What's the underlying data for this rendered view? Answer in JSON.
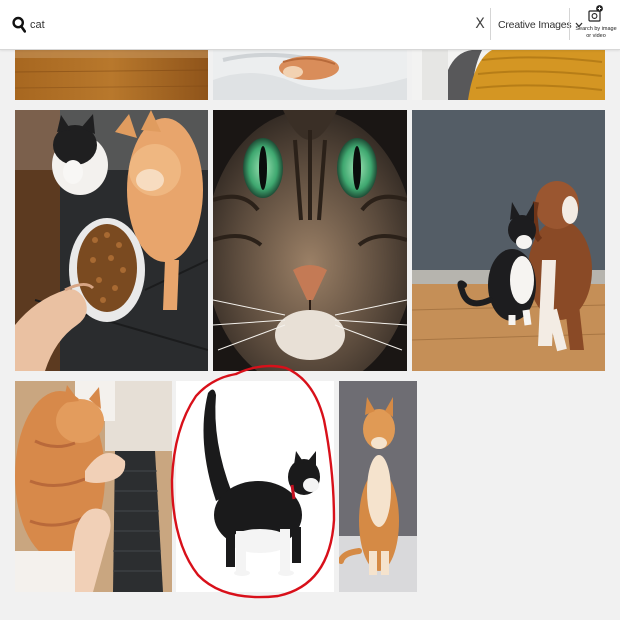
{
  "search": {
    "query": "cat",
    "clear_label": "X",
    "filter_label": "Creative Images",
    "image_search_label": "Search by image or video"
  },
  "colors": {
    "annotation": "#d8101a",
    "page_background": "#f1f1f1"
  },
  "results": [
    {
      "subject": "wooden floor",
      "selected": false
    },
    {
      "subject": "cat on white bedsheet",
      "selected": false
    },
    {
      "subject": "cat with knitted sweater",
      "selected": false
    },
    {
      "subject": "two cats eating from food bowl",
      "selected": false
    },
    {
      "subject": "tabby cat face closeup",
      "selected": false
    },
    {
      "subject": "cat and dog sitting together",
      "selected": false
    },
    {
      "subject": "cat lying next to keyboard",
      "selected": false
    },
    {
      "subject": "black and white cat walking",
      "selected": true
    },
    {
      "subject": "orange and white cat sitting",
      "selected": false
    }
  ]
}
